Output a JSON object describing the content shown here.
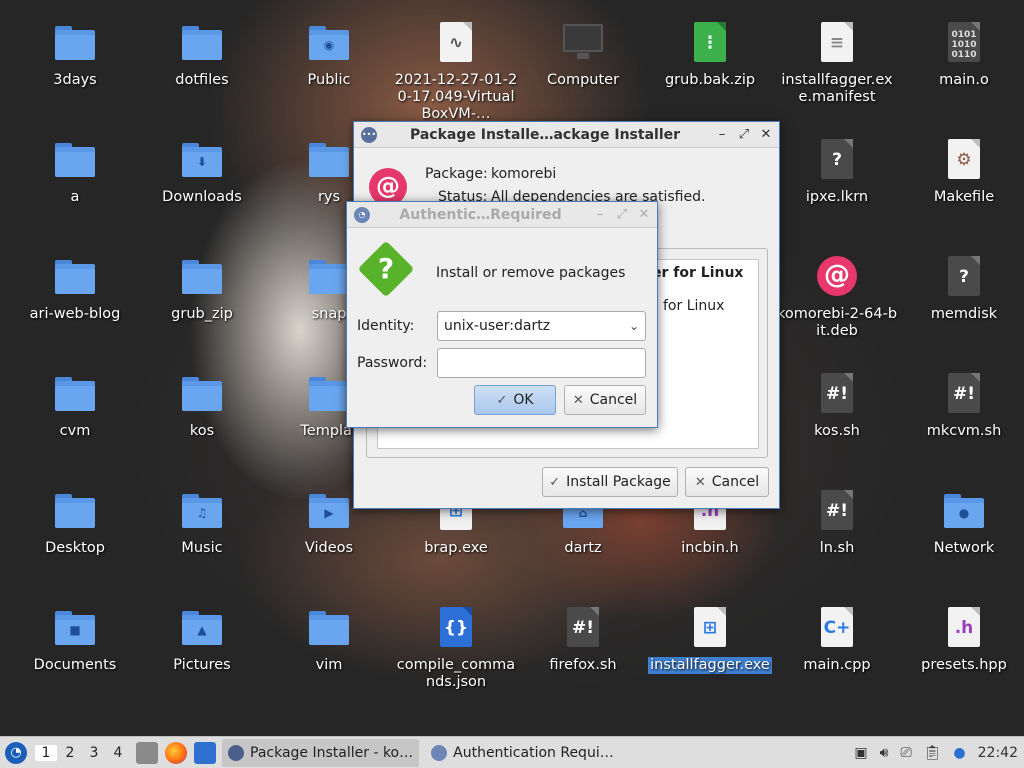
{
  "desktop_icons": [
    {
      "name": "3days",
      "type": "folder"
    },
    {
      "name": "dotfiles",
      "type": "folder"
    },
    {
      "name": "Public",
      "type": "folder",
      "emblem": "person"
    },
    {
      "name": "2021-12-27-01-20-17.049-VirtualBoxVM-…",
      "type": "file"
    },
    {
      "name": "Computer",
      "type": "computer"
    },
    {
      "name": "grub.bak.zip",
      "type": "zip"
    },
    {
      "name": "installfagger.exe.manifest",
      "type": "text"
    },
    {
      "name": "main.o",
      "type": "binary"
    },
    {
      "name": "a",
      "type": "folder"
    },
    {
      "name": "Downloads",
      "type": "folder",
      "emblem": "download"
    },
    {
      "name": "rys",
      "type": "folder"
    },
    {
      "name": "ipxe.lkrn",
      "type": "unknown"
    },
    {
      "name": "Makefile",
      "type": "makefile"
    },
    {
      "name": "ari-web-blog",
      "type": "folder"
    },
    {
      "name": "grub_zip",
      "type": "folder"
    },
    {
      "name": "snap",
      "type": "folder"
    },
    {
      "name": "komorebi-2-64-bit.deb",
      "type": "deb"
    },
    {
      "name": "memdisk",
      "type": "unknown"
    },
    {
      "name": "cvm",
      "type": "folder"
    },
    {
      "name": "kos",
      "type": "folder"
    },
    {
      "name": "Templat",
      "type": "folder"
    },
    {
      "name": "kos.sh",
      "type": "script"
    },
    {
      "name": "mkcvm.sh",
      "type": "script"
    },
    {
      "name": "Desktop",
      "type": "folder"
    },
    {
      "name": "Music",
      "type": "folder",
      "emblem": "music"
    },
    {
      "name": "Videos",
      "type": "folder",
      "emblem": "video"
    },
    {
      "name": "brap.exe",
      "type": "exe"
    },
    {
      "name": "dartz",
      "type": "folder-home"
    },
    {
      "name": "incbin.h",
      "type": "header"
    },
    {
      "name": "ln.sh",
      "type": "script"
    },
    {
      "name": "Network",
      "type": "folder",
      "emblem": "globe"
    },
    {
      "name": "Documents",
      "type": "folder",
      "emblem": "document"
    },
    {
      "name": "Pictures",
      "type": "folder",
      "emblem": "picture"
    },
    {
      "name": "vim",
      "type": "folder"
    },
    {
      "name": "compile_commands.json",
      "type": "json"
    },
    {
      "name": "firefox.sh",
      "type": "script"
    },
    {
      "name": "installfagger.exe",
      "type": "exe",
      "selected": true
    },
    {
      "name": "main.cpp",
      "type": "cpp"
    },
    {
      "name": "presets.hpp",
      "type": "header"
    }
  ],
  "package_installer": {
    "title": "Package Installe…ackage Installer",
    "package_label": "Package:",
    "package_value": "komorebi",
    "status_label": "Status:",
    "status_value": "All dependencies are satisfied.",
    "details_heading": "ger for Linux",
    "details_text": "for Linux",
    "install_button": "Install Package",
    "cancel_button": "Cancel"
  },
  "auth_dialog": {
    "title": "Authentic…Required",
    "message": "Install or remove packages",
    "identity_label": "Identity:",
    "identity_value": "unix-user:dartz",
    "password_label": "Password:",
    "password_value": "",
    "ok_button": "OK",
    "cancel_button": "Cancel"
  },
  "taskbar": {
    "workspaces": [
      "1",
      "2",
      "3",
      "4"
    ],
    "active_workspace": "1",
    "tasks": [
      {
        "label": "Package Installer - ko…",
        "active": true
      },
      {
        "label": "Authentication Requi…",
        "active": false
      }
    ],
    "clock": "22:42"
  }
}
